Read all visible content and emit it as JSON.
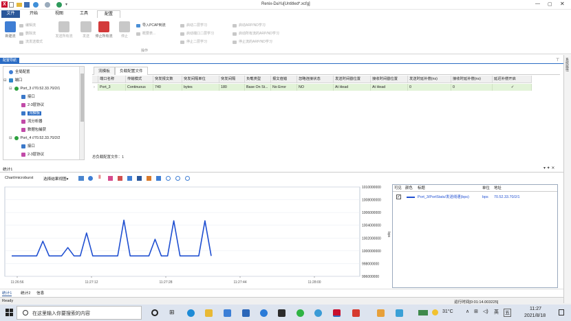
{
  "window": {
    "title": "Renix-DaYu[Untitled*.xcfg]",
    "app_logo": "X"
  },
  "menus": [
    {
      "label": "文件"
    },
    {
      "label": "开始"
    },
    {
      "label": "视图"
    },
    {
      "label": "工具"
    },
    {
      "label": "配置"
    }
  ],
  "ribbon": {
    "new_stream": "新建流",
    "edit_stream": "编辑流",
    "delete_stream": "删除流",
    "stream_template": "流发送模式",
    "send_all": "发送所有流",
    "send": "发送",
    "stop_all": "停止所有流",
    "stop": "停止",
    "import_pcap": "导入PCAP到流",
    "stream_wizard": "概要表...",
    "start_l2": "启动二层学习",
    "start_port_l2": "启动端口二层学习",
    "stop_l2": "停止二层学习",
    "start_arp": "启动ARP/ND学习",
    "start_all_arp": "启动所有流的ARP/ND学习",
    "stop_arp": "停止流的ARP/ND学习",
    "group_label": "操作"
  },
  "nav": {
    "title": "配置导航",
    "items": [
      {
        "label": "全局配置"
      },
      {
        "label": "端口"
      },
      {
        "label": "Port_3 //70.52.33.70/2/1"
      },
      {
        "label": "接口"
      },
      {
        "label": "2-3层协议"
      },
      {
        "label": "流模板"
      },
      {
        "label": "流分析器"
      },
      {
        "label": "数据包捕获"
      },
      {
        "label": "Port_4 //70.52.33.70/2/2"
      },
      {
        "label": "接口"
      },
      {
        "label": "2-3层协议"
      }
    ]
  },
  "tabs": [
    {
      "label": "流模板"
    },
    {
      "label": "负载配置文件"
    }
  ],
  "grid": {
    "headers": [
      "端口名称",
      "传输模式",
      "突发报文数",
      "突发间隔单位",
      "突发间隔",
      "负载类型",
      "报文值错",
      "忽略连接状态",
      "发送时间戳位置",
      "接收时间戳位置",
      "发送时延补偿(ns)",
      "接收时延补偿(ns)",
      "延迟补偿开启"
    ],
    "row": [
      "Port_3",
      "Continuous",
      "740",
      "bytes",
      "180",
      "Base On St...",
      "No Error",
      "NO",
      "At Head",
      "At Head",
      "0",
      "0",
      "✓"
    ],
    "footer": "总负载配置文件：1"
  },
  "stats_panel": {
    "title": "统计1",
    "view_label": "Chart/microburst",
    "select_view": "选择结果视图",
    "pin_icons": "▾ ✦ ✕"
  },
  "chart_data": {
    "type": "line",
    "x_ticks": [
      "11:26:56",
      "11:27:12",
      "11:27:28",
      "11:27:44",
      "11:28:00"
    ],
    "y_ticks": [
      "1010000000",
      "1008000000",
      "1006000000",
      "1004000000",
      "1002000000",
      "1000000000",
      "998000000",
      "996000000"
    ],
    "ylabel": "bps",
    "ylim": [
      996000000,
      1010000000
    ],
    "series": [
      {
        "name": "Port_3/PortStats/发送线速(bps)",
        "color": "#1f4fd1",
        "values": [
          999200000,
          999200000,
          999200000,
          999200000,
          999200000,
          1001500000,
          999200000,
          999200000,
          999200000,
          1000500000,
          999200000,
          999200000,
          1002800000,
          999200000,
          999200000,
          999200000,
          999200000,
          999200000,
          1004800000,
          999200000,
          999200000,
          999200000,
          999200000,
          1001800000,
          999200000,
          999200000,
          1004700000,
          999200000,
          999200000,
          999200000,
          999200000,
          1004700000,
          999200000
        ]
      }
    ]
  },
  "legend": {
    "headers": [
      "可见",
      "颜色",
      "标题",
      "单位",
      "地址"
    ],
    "row": {
      "title": "Port_3/PortStats/发送线速(bps)",
      "unit": "bps",
      "address": "70.52.33.70/2/1"
    }
  },
  "bottom_tabs": [
    {
      "label": "统计1"
    },
    {
      "label": "统计2"
    },
    {
      "label": "信息"
    }
  ],
  "status": {
    "left": "Ready",
    "runtime": "运行时间[0:01:14.003225]"
  },
  "taskbar": {
    "search_placeholder": "在这里输入你要搜索的内容",
    "temperature": "31°C",
    "ime": "英",
    "ime2": "五",
    "time": "11:27",
    "date": "2021/8/18"
  },
  "right_sidebar": {
    "label": "系统属性"
  }
}
